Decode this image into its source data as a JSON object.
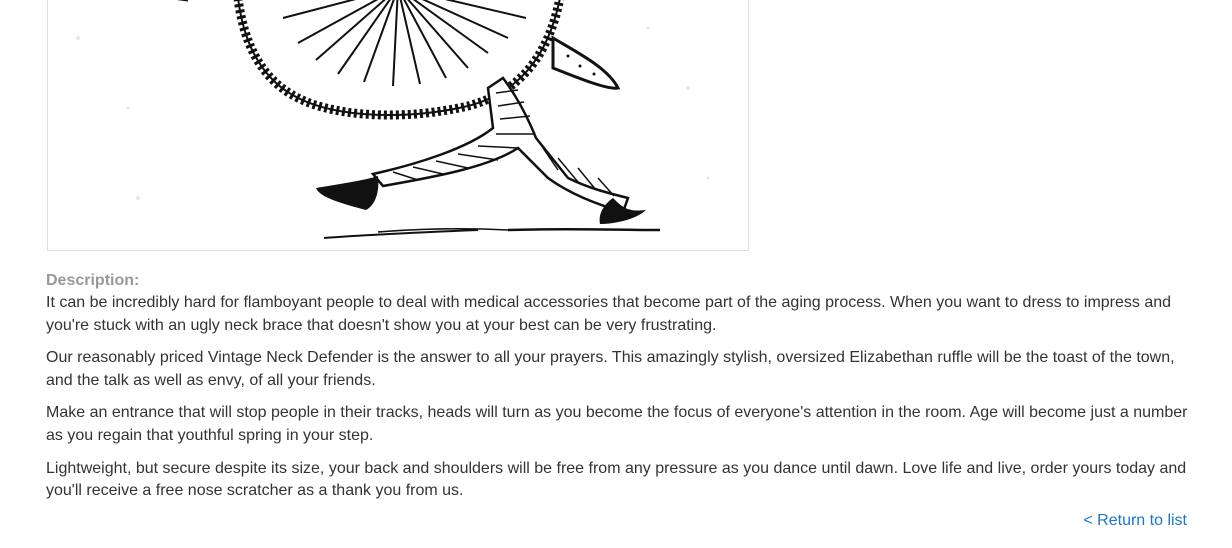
{
  "product": {
    "image_alt": "Vintage Neck Defender illustration",
    "description_label": "Description:",
    "paragraphs": [
      "It can be incredibly hard for flamboyant people to deal with medical accessories that become part of the aging process. When you want to dress to impress and you're stuck with an ugly neck brace that doesn't show you at your best can be very frustrating.",
      "Our reasonably priced Vintage Neck Defender is the answer to all your prayers. This amazingly stylish, oversized Elizabethan ruffle will be the toast of the town, and the talk as well as envy, of all your friends.",
      "Make an entrance that will stop people in their tracks, heads will turn as you become the focus of everyone's attention in the room. Age will become just a number as you regain that youthful spring in your step.",
      "Lightweight, but secure despite its size, your back and shoulders will be free from any pressure as you dance until dawn. Love life and live, order yours today and you'll receive a free nose scratcher as a thank you from us."
    ]
  },
  "navigation": {
    "return_label": "< Return to list"
  }
}
